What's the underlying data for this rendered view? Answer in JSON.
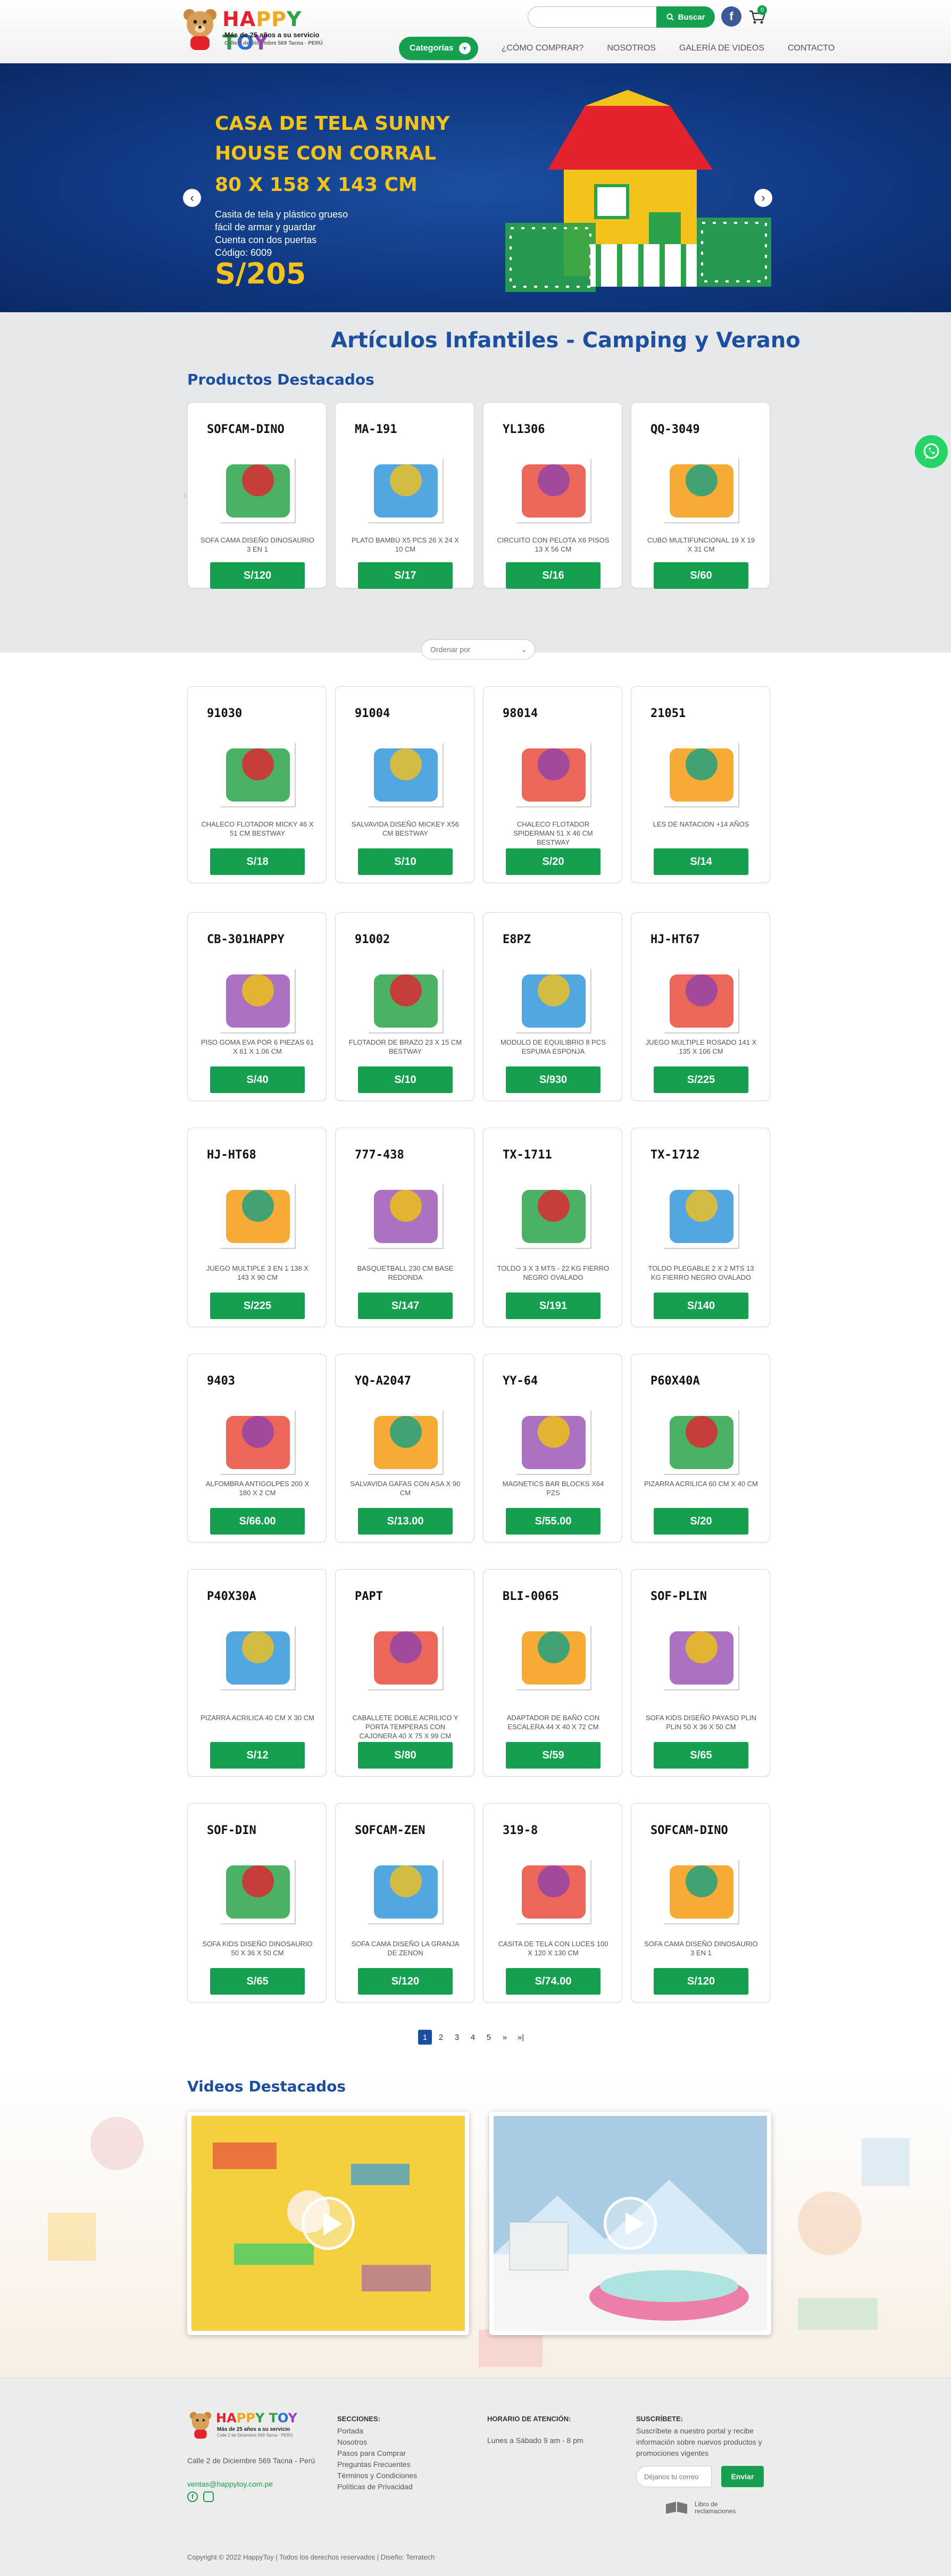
{
  "header": {
    "logo": {
      "title_parts": [
        "HA",
        "PP",
        "Y T",
        "O",
        "Y"
      ],
      "subtitle": "Más de 25 años a su servicio",
      "address_line": "Calle 2 de Diciembre 569 Tacna · PERÚ"
    },
    "search": {
      "placeholder": "",
      "button_label": "Buscar"
    },
    "cart_count": "0",
    "nav": {
      "categories_label": "Categorías",
      "items": [
        "¿CÓMO COMPRAR?",
        "NOSOTROS",
        "GALERÍA DE VIDEOS",
        "CONTACTO"
      ]
    }
  },
  "hero": {
    "title": "CASA DE TELA SUNNY HOUSE CON CORRAL",
    "dims": "80 X 158 X 143 CM",
    "lines": [
      "Casita de tela y plástico grueso",
      "fácil de armar y guardar",
      "Cuenta con dos puertas",
      "Código: 6009"
    ],
    "price": "S/205"
  },
  "category_title": "Artículos Infantiles - Camping y Verano",
  "featured": {
    "title": "Productos Destacados",
    "items": [
      {
        "code": "SOFCAM-DINO",
        "name": "SOFA CAMA DISEÑO DINOSAURIO 3 EN 1",
        "price": "S/120"
      },
      {
        "code": "MA-191",
        "name": "PLATO BAMBU X5 PCS 26 X 24 X 10 CM",
        "price": "S/17"
      },
      {
        "code": "YL1306",
        "name": "CIRCUITO CON PELOTA X6 PISOS 13 X 56 CM",
        "price": "S/16"
      },
      {
        "code": "QQ-3049",
        "name": "CUBO MULTIFUNCIONAL 19 X 19 X 31 CM",
        "price": "S/60"
      }
    ]
  },
  "sort": {
    "placeholder": "Ordenar por"
  },
  "products": [
    {
      "code": "91030",
      "name": "CHALECO FLOTADOR MICKY 46 X 51 CM BESTWAY",
      "price": "S/18"
    },
    {
      "code": "91004",
      "name": "SALVAVIDA DISEÑO MICKEY X56 CM BESTWAY",
      "price": "S/10"
    },
    {
      "code": "98014",
      "name": "CHALECO FLOTADOR SPIDERMAN 51 X 46 CM BESTWAY",
      "price": "S/20"
    },
    {
      "code": "21051",
      "name": "LES DE NATACION +14 AÑOS",
      "price": "S/14"
    },
    {
      "code": "CB-301HAPPY",
      "name": "PISO GOMA EVA POR 6 PIEZAS 61 X 61 X 1.06 CM",
      "price": "S/40"
    },
    {
      "code": "91002",
      "name": "FLOTADOR DE BRAZO 23 X 15 CM BESTWAY",
      "price": "S/10"
    },
    {
      "code": "E8PZ",
      "name": "MODULO DE EQUILIBRIO 8 PCS ESPUMA ESPONJA",
      "price": "S/930"
    },
    {
      "code": "HJ-HT67",
      "name": "JUEGO MULTIPLE ROSADO 141 X 135 X 106 CM",
      "price": "S/225"
    },
    {
      "code": "HJ-HT68",
      "name": "JUEGO MULTIPLE 3 EN 1 138 X 143 X 90 CM",
      "price": "S/225"
    },
    {
      "code": "777-438",
      "name": "BASQUETBALL 230 CM BASE REDONDA",
      "price": "S/147"
    },
    {
      "code": "TX-1711",
      "name": "TOLDO 3 X 3 MTS - 22 KG FIERRO NEGRO OVALADO",
      "price": "S/191"
    },
    {
      "code": "TX-1712",
      "name": "TOLDO PLEGABLE 2 X 2 MTS 13 KG FIERRO NEGRO OVALADO",
      "price": "S/140"
    },
    {
      "code": "9403",
      "name": "ALFOMBRA ANTIGOLPES 200 X 180 X 2 CM",
      "price": "S/66.00"
    },
    {
      "code": "YQ-A2047",
      "name": "SALVAVIDA GAFAS CON ASA X 90 CM",
      "price": "S/13.00"
    },
    {
      "code": "YY-64",
      "name": "MAGNETICS BAR BLOCKS X64 PZS",
      "price": "S/55.00"
    },
    {
      "code": "P60X40A",
      "name": "PIZARRA ACRILICA 60 CM X 40 CM",
      "price": "S/20"
    },
    {
      "code": "P40X30A",
      "name": "PIZARRA ACRILICA 40 CM X 30 CM",
      "price": "S/12"
    },
    {
      "code": "PAPT",
      "name": "CABALLETE DOBLE ACRILICO Y PORTA TEMPERAS CON CAJONERA 40 X 75 X 99 CM",
      "price": "S/80"
    },
    {
      "code": "BLI-0065",
      "name": "ADAPTADOR DE BAÑO CON ESCALERA 44 X 40 X 72 CM",
      "price": "S/59"
    },
    {
      "code": "SOF-PLIN",
      "name": "SOFA KIDS DISEÑO PAYASO PLIN PLIN 50 X 36 X 50 CM",
      "price": "S/65"
    },
    {
      "code": "SOF-DIN",
      "name": "SOFA KIDS DISEÑO DINOSAURIO 50 X 36 X 50 CM",
      "price": "S/65"
    },
    {
      "code": "SOFCAM-ZEN",
      "name": "SOFA CAMA DISEÑO LA GRANJA DE ZENON",
      "price": "S/120"
    },
    {
      "code": "319-8",
      "name": "CASITA DE TELA CON LUCES 100 X 120 X 130 CM",
      "price": "S/74.00"
    },
    {
      "code": "SOFCAM-DINO",
      "name": "SOFA CAMA DISEÑO DINOSAURIO 3 EN 1",
      "price": "S/120"
    }
  ],
  "pagination": [
    "1",
    "2",
    "3",
    "4",
    "5",
    "»",
    "»|"
  ],
  "videos": {
    "title": "Videos Destacados"
  },
  "footer": {
    "address": "Calle 2 de Diciembre 569 Tacna - Perú",
    "email": "ventas@happytoy.com.pe",
    "sections_title": "SECCIONES:",
    "sections": [
      "Portada",
      "Nosotros",
      "Pasos para Comprar",
      "Preguntas Frecuentes",
      "Términos y Condiciones",
      "Políticas de Privacidad"
    ],
    "hours_title": "HORARIO DE ATENCIÓN:",
    "hours": "Lunes a Sábado 9 am - 8 pm",
    "subscribe_title": "SUSCRÍBETE:",
    "subscribe_text": "Suscríbete a nuestro portal y recibe información sobre nuevos productos y promociones vigentes",
    "subscribe_placeholder": "Déjanos tu correo",
    "subscribe_button": "Enviar",
    "book_label_1": "Libro de",
    "book_label_2": "reclamaciones",
    "copyright": "Copyright © 2022 HappyToy | Todos los derechos reservados | Diseño: Terratech"
  },
  "colors": {
    "brand_green": "#14a04e",
    "brand_blue": "#1c4fa0",
    "hero_yellow": "#f3c21b"
  }
}
